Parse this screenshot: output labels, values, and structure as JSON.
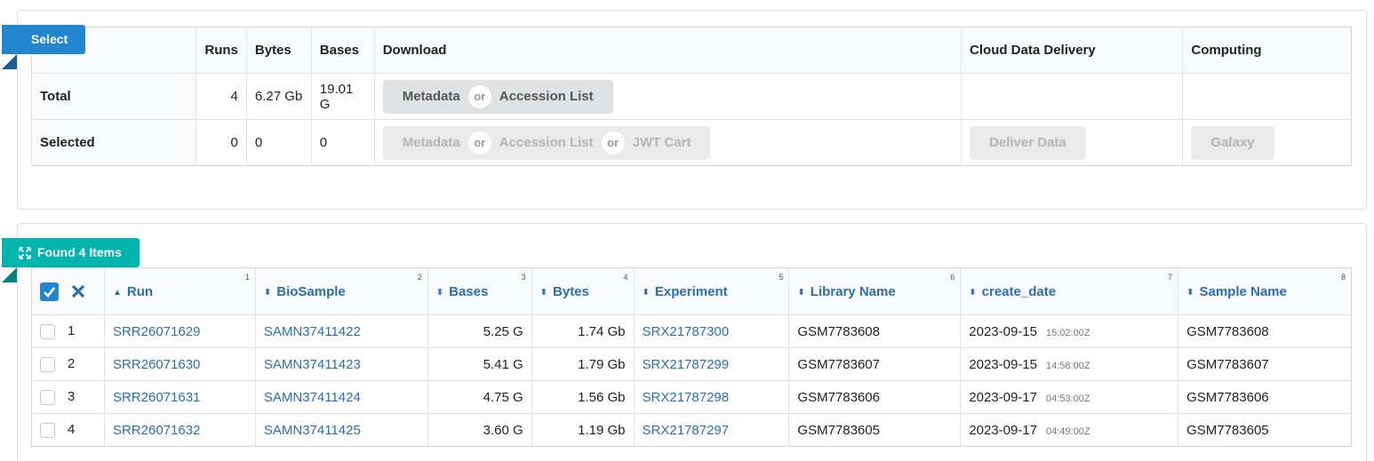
{
  "select_ribbon": "Select",
  "found_ribbon": "Found 4 Items",
  "summary": {
    "headers": [
      "Runs",
      "Bytes",
      "Bases",
      "Download",
      "Cloud Data Delivery",
      "Computing"
    ],
    "total": {
      "label": "Total",
      "runs": "4",
      "bytes": "6.27 Gb",
      "bases": "19.01 G"
    },
    "selected": {
      "label": "Selected",
      "runs": "0",
      "bytes": "0",
      "bases": "0"
    },
    "buttons": {
      "metadata": "Metadata",
      "or": "or",
      "accession_list": "Accession List",
      "jwt_cart": "JWT Cart",
      "deliver_data": "Deliver Data",
      "galaxy": "Galaxy"
    }
  },
  "results": {
    "columns": [
      {
        "label": "Run",
        "num": "1"
      },
      {
        "label": "BioSample",
        "num": "2"
      },
      {
        "label": "Bases",
        "num": "3"
      },
      {
        "label": "Bytes",
        "num": "4"
      },
      {
        "label": "Experiment",
        "num": "5"
      },
      {
        "label": "Library Name",
        "num": "6"
      },
      {
        "label": "create_date",
        "num": "7"
      },
      {
        "label": "Sample Name",
        "num": "8"
      }
    ],
    "rows": [
      {
        "idx": "1",
        "run": "SRR26071629",
        "biosample": "SAMN37411422",
        "bases": "5.25 G",
        "bytes": "1.74 Gb",
        "experiment": "SRX21787300",
        "library": "GSM7783608",
        "date": "2023-09-15",
        "time": "15:02:00Z",
        "sample": "GSM7783608"
      },
      {
        "idx": "2",
        "run": "SRR26071630",
        "biosample": "SAMN37411423",
        "bases": "5.41 G",
        "bytes": "1.79 Gb",
        "experiment": "SRX21787299",
        "library": "GSM7783607",
        "date": "2023-09-15",
        "time": "14:58:00Z",
        "sample": "GSM7783607"
      },
      {
        "idx": "3",
        "run": "SRR26071631",
        "biosample": "SAMN37411424",
        "bases": "4.75 G",
        "bytes": "1.56 Gb",
        "experiment": "SRX21787298",
        "library": "GSM7783606",
        "date": "2023-09-17",
        "time": "04:53:00Z",
        "sample": "GSM7783606"
      },
      {
        "idx": "4",
        "run": "SRR26071632",
        "biosample": "SAMN37411425",
        "bases": "3.60 G",
        "bytes": "1.19 Gb",
        "experiment": "SRX21787297",
        "library": "GSM7783605",
        "date": "2023-09-17",
        "time": "04:49:00Z",
        "sample": "GSM7783605"
      }
    ]
  },
  "colors": {
    "blue": "#2185d0",
    "teal": "#00b5ad",
    "link": "#2a6fb0"
  }
}
